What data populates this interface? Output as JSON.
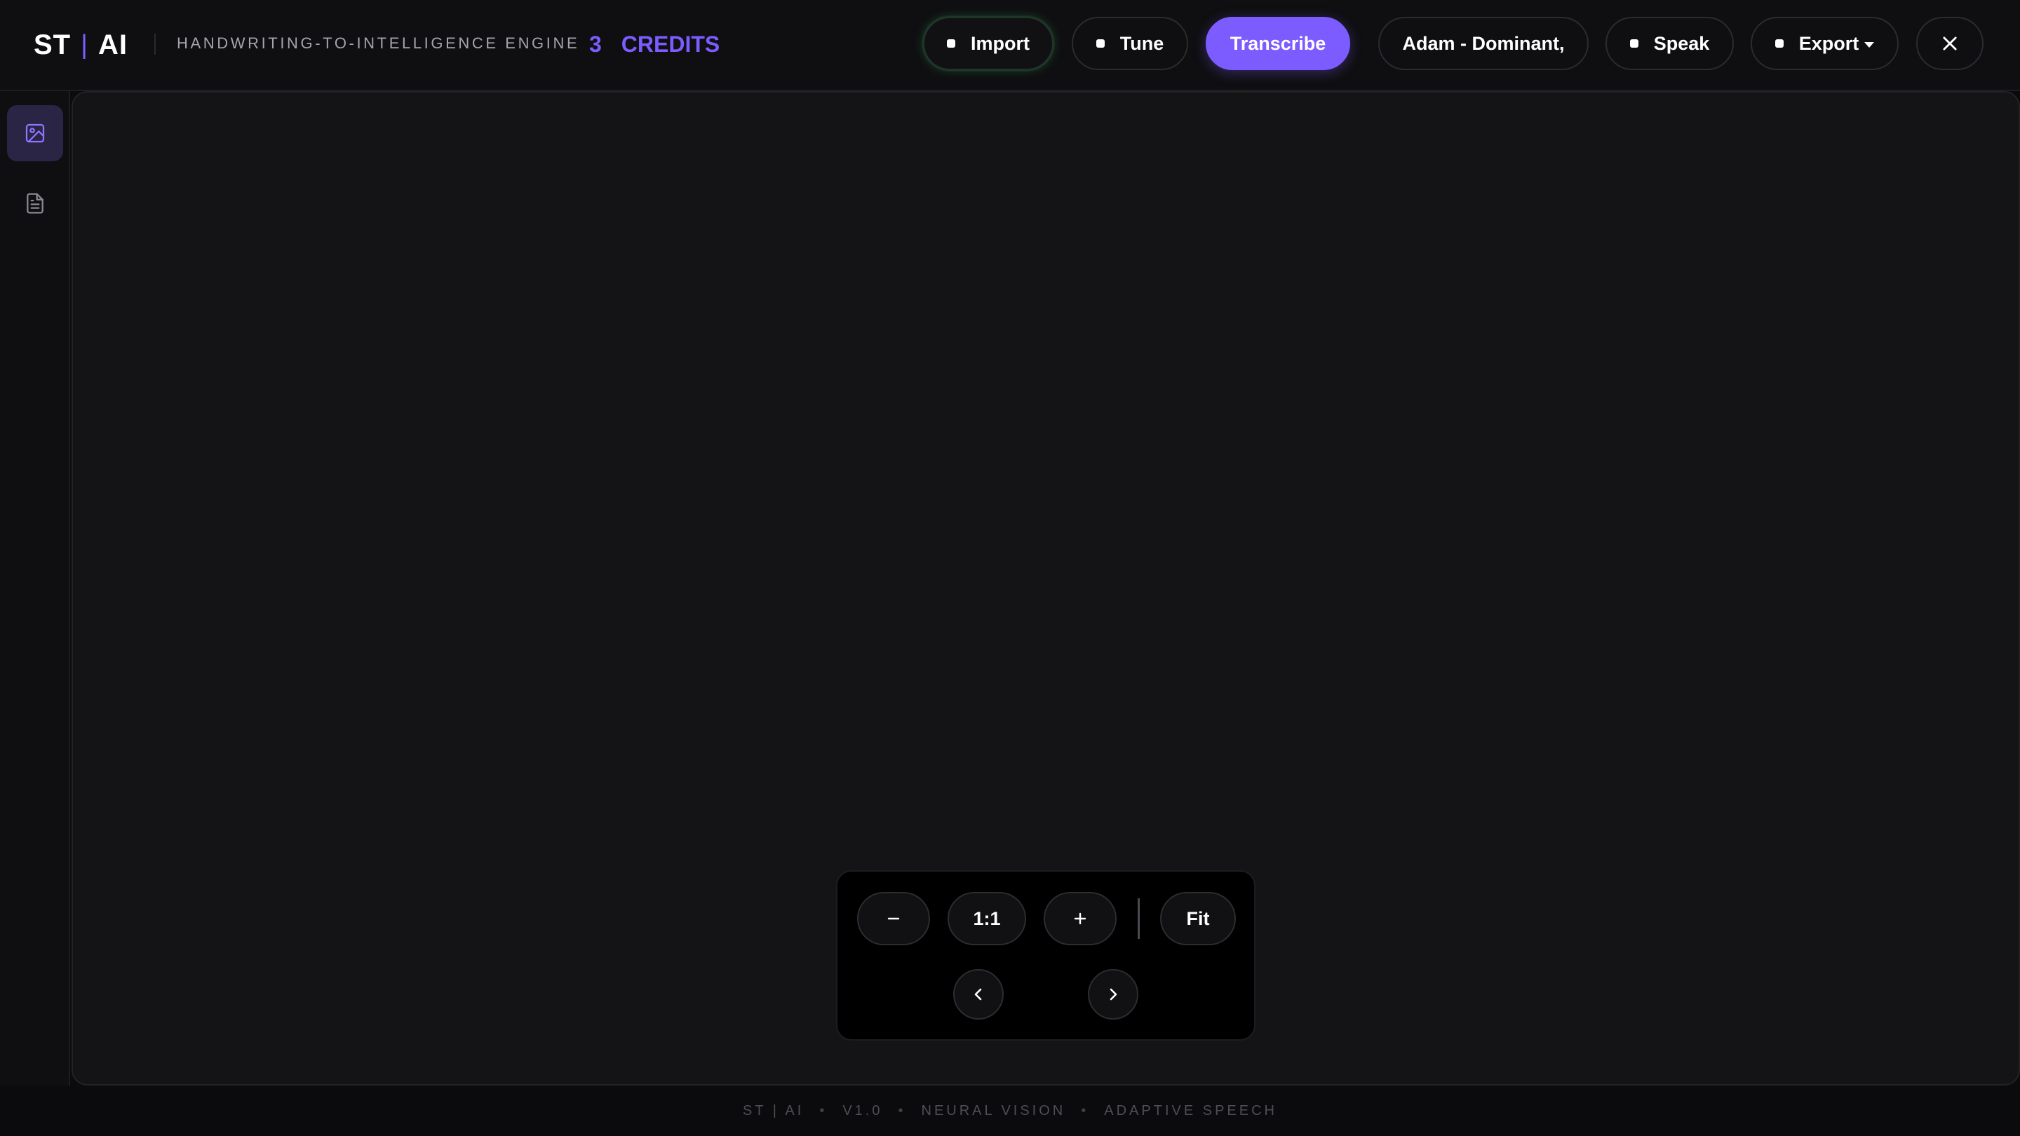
{
  "header": {
    "brand_left": "ST",
    "brand_sep": "|",
    "brand_right": "AI",
    "tagline": "HANDWRITING-TO-INTELLIGENCE ENGINE",
    "credits_count": "3",
    "credits_label": "CREDITS",
    "buttons": {
      "import": "Import",
      "tune": "Tune",
      "transcribe": "Transcribe",
      "voice": "Adam - Dominant,",
      "speak": "Speak",
      "export": "Export"
    }
  },
  "zoom": {
    "one_to_one": "1:1",
    "fit": "Fit"
  },
  "footer": {
    "brand": "ST | AI",
    "version": "V1.0",
    "feature_1": "NEURAL VISION",
    "feature_2": "ADAPTIVE SPEECH",
    "separator": "•"
  },
  "colors": {
    "accent": "#7c5cff",
    "background": "#0b0b0d",
    "canvas": "#141416",
    "import_glow": "#3cc86e"
  },
  "icons": {
    "sidebar_image": "image-icon",
    "sidebar_document": "document-icon",
    "close": "close-icon",
    "export_caret": "chevron-down-icon",
    "zoom_out": "minus-icon",
    "zoom_in": "plus-icon",
    "previous": "chevron-left-icon",
    "next": "chevron-right-icon"
  }
}
